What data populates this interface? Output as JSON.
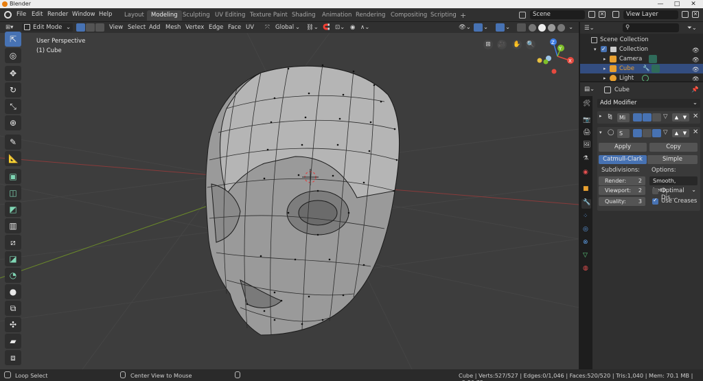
{
  "titlebar": {
    "title": "Blender",
    "minimize": "—",
    "maximize": "□",
    "close": "✕"
  },
  "menu": [
    "File",
    "Edit",
    "Render",
    "Window",
    "Help"
  ],
  "workspaces": [
    {
      "label": "Layout",
      "active": false
    },
    {
      "label": "Modeling",
      "active": true
    },
    {
      "label": "Sculpting",
      "active": false
    },
    {
      "label": "UV Editing",
      "active": false
    },
    {
      "label": "Texture Paint",
      "active": false
    },
    {
      "label": "Shading",
      "active": false
    },
    {
      "label": "Animation",
      "active": false
    },
    {
      "label": "Rendering",
      "active": false
    },
    {
      "label": "Compositing",
      "active": false
    },
    {
      "label": "Scripting",
      "active": false
    }
  ],
  "add_workspace": "+",
  "scene": {
    "name": "Scene"
  },
  "view_layer": {
    "name": "View Layer"
  },
  "viewport_header": {
    "mode": "Edit Mode",
    "menus": [
      "View",
      "Select",
      "Add",
      "Mesh",
      "Vertex",
      "Edge",
      "Face",
      "UV"
    ],
    "transform_orientation": "Global"
  },
  "viewport": {
    "overlay_line1": "User Perspective",
    "overlay_line2": "(1) Cube",
    "gizmo": {
      "x": "X",
      "y": "Y",
      "z": "Z"
    },
    "colors": {
      "x": "#e64a3f",
      "y": "#7fbf2a",
      "z": "#3f7fe6"
    }
  },
  "tools": [
    "select-box",
    "cursor",
    "move",
    "rotate",
    "scale",
    "transform",
    "annotate",
    "measure",
    "extrude",
    "inset",
    "bevel",
    "loop-cut",
    "knife",
    "poly-build",
    "spin",
    "smooth",
    "edge-slide",
    "shrink-fatten",
    "shear",
    "rip-region"
  ],
  "outliner": {
    "search_placeholder": "",
    "scene_collection": "Scene Collection",
    "items": [
      {
        "label": "Collection",
        "kind": "collection"
      },
      {
        "label": "Camera",
        "kind": "camera"
      },
      {
        "label": "Cube",
        "kind": "mesh",
        "active": true
      },
      {
        "label": "Light",
        "kind": "light"
      }
    ]
  },
  "properties": {
    "object_name": "Cube",
    "add_modifier": "Add Modifier",
    "modifiers": [
      {
        "short": "Mi",
        "collapsed": true
      },
      {
        "short": "S",
        "collapsed": false
      }
    ],
    "apply": "Apply",
    "copy": "Copy",
    "subdiv_types": [
      "Catmull-Clark",
      "Simple"
    ],
    "subdivisions_label": "Subdivisions:",
    "options_label": "Options:",
    "render": {
      "label": "Render:",
      "value": "2"
    },
    "viewport": {
      "label": "Viewport:",
      "value": "2"
    },
    "quality": {
      "label": "Quality:",
      "value": "3"
    },
    "uv_smooth": "Smooth, keep...",
    "optimal_display": {
      "label": "Optimal Dis...",
      "checked": false
    },
    "use_creases": {
      "label": "Use Creases",
      "checked": true
    }
  },
  "statusbar": {
    "left_action": "Loop Select",
    "middle_action": "Center View to Mouse",
    "stats": "Cube | Verts:527/527 | Edges:0/1,046 | Faces:520/520 | Tris:1,040 | Mem: 70.1 MB | v2.80.75"
  },
  "colors": {
    "accent": "#4772b3",
    "active_object": "#e8a030",
    "background": "#3d3d3d"
  }
}
